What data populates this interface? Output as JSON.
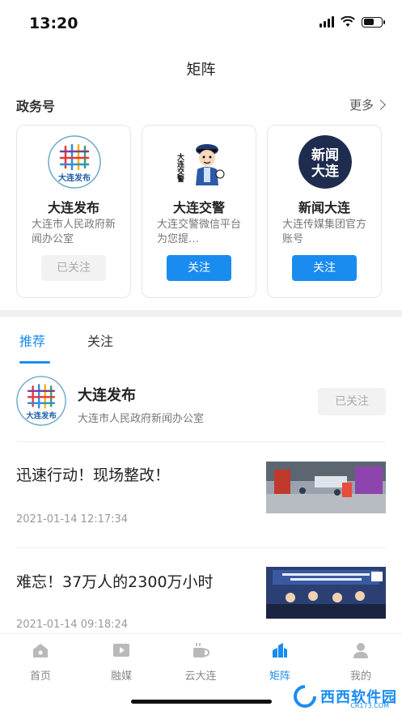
{
  "status": {
    "time": "13:20"
  },
  "header": {
    "title": "矩阵"
  },
  "gov_section": {
    "title": "政务号",
    "more_label": "更多",
    "cards": [
      {
        "name": "大连发布",
        "desc": "大连市人民政府新闻办公室",
        "button": "已关注",
        "followed": true
      },
      {
        "name": "大连交警",
        "desc": "大连交警微信平台为您提…",
        "button": "关注",
        "followed": false
      },
      {
        "name": "新闻大连",
        "desc": "大连传媒集团官方账号",
        "button": "关注",
        "followed": false
      }
    ]
  },
  "logos": {
    "dalian_fabu_text": "大连发布",
    "jiaojing_text": "大连交警",
    "xinwen_text": [
      "新闻",
      "大连"
    ]
  },
  "tabs": [
    {
      "label": "推荐",
      "active": true
    },
    {
      "label": "关注",
      "active": false
    }
  ],
  "account": {
    "name": "大连发布",
    "desc": "大连市人民政府新闻办公室",
    "button": "已关注"
  },
  "news": [
    {
      "title": "迅速行动！现场整改！",
      "time": "2021-01-14 12:17:34"
    },
    {
      "title": "难忘！37万人的2300万小时",
      "time": "2021-01-14 09:18:24"
    }
  ],
  "bottom_nav": [
    {
      "label": "首页",
      "icon": "home-icon",
      "active": false
    },
    {
      "label": "融媒",
      "icon": "video-icon",
      "active": false
    },
    {
      "label": "云大连",
      "icon": "coffee-cup-icon",
      "active": false
    },
    {
      "label": "矩阵",
      "icon": "buildings-icon",
      "active": true
    },
    {
      "label": "我的",
      "icon": "user-icon",
      "active": false
    }
  ],
  "colors": {
    "accent": "#1a8cf0",
    "muted_button": "#f2f2f2"
  },
  "watermark": {
    "text": "西西软件园",
    "sub": "CR173.COM"
  }
}
